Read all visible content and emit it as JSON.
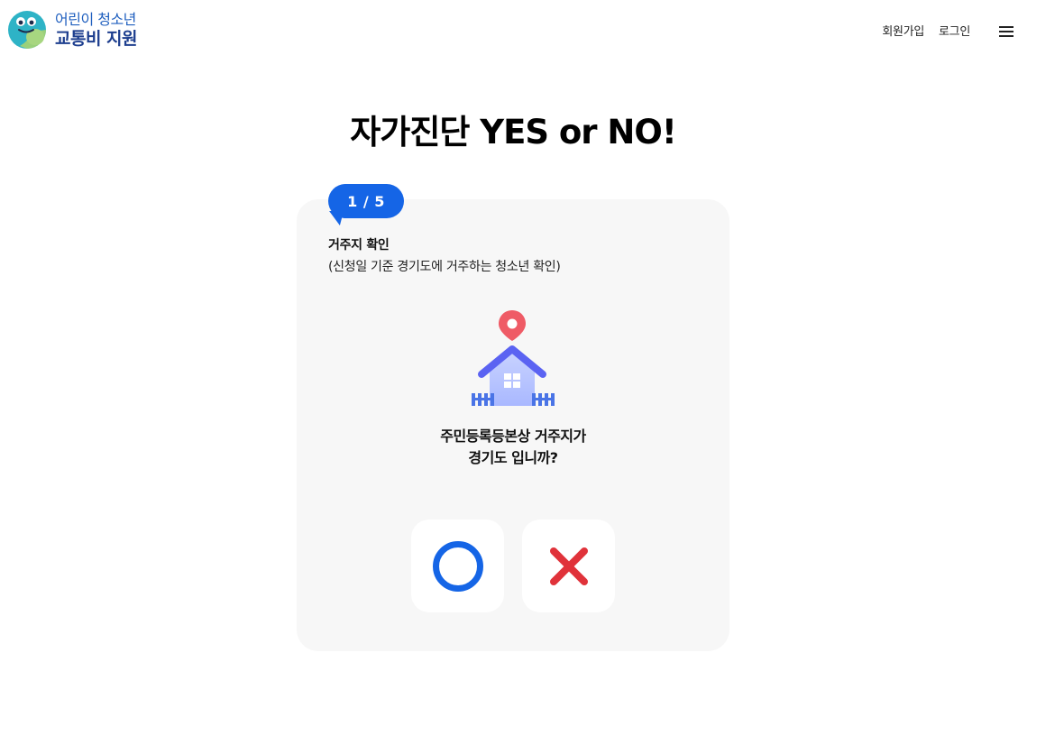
{
  "header": {
    "logo_line1": "어린이 청소년",
    "logo_line2": "교통비 지원",
    "signup_label": "회원가입",
    "login_label": "로그인",
    "menu_icon": "hamburger-menu-icon"
  },
  "page": {
    "title": "자가진단 YES or NO!"
  },
  "quiz": {
    "step": "1 / 5",
    "heading": "거주지 확인",
    "subheading": "(신청일 기준 경기도에 거주하는 청소년 확인)",
    "illustration_icon": "house-location-pin-icon",
    "question_line1": "주민등록등본상 거주지가",
    "question_line2": "경기도 입니까?",
    "yes_icon": "circle-o-icon",
    "no_icon": "cross-x-icon"
  },
  "colors": {
    "accent": "#1565e6",
    "no_red": "#e0323a",
    "card_bg": "#f7f7f7",
    "logo_blue": "#1e3f8f"
  }
}
